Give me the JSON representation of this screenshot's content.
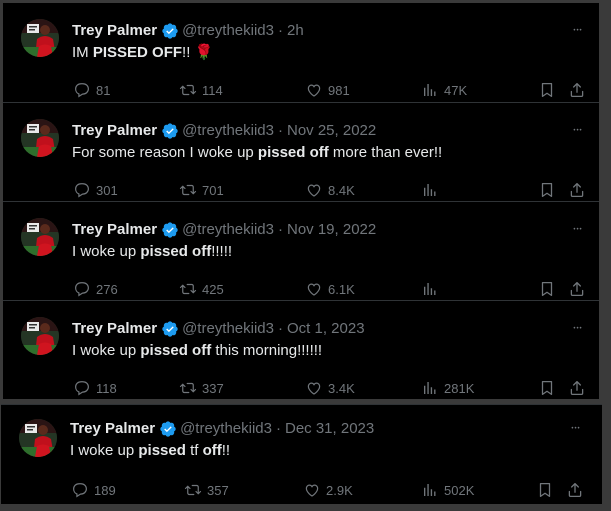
{
  "colors": {
    "verified": "#1d9bf0",
    "secondary_text": "#71767b",
    "primary_text": "#e7e9ea",
    "background": "#000000",
    "divider": "#2f3336"
  },
  "icons": {
    "reply": "speech-bubble",
    "retweet": "retweet-arrows",
    "like": "heart",
    "views": "bar-chart",
    "bookmark": "bookmark",
    "share": "upload-arrow",
    "verified": "verified-badge",
    "more": "three-dots"
  },
  "tweets": [
    {
      "name": "Trey Palmer",
      "handle": "@treythekiid3",
      "time": "2h",
      "text_parts": [
        "IM ",
        "PISSED OFF",
        "!! 🌹"
      ],
      "replies": "81",
      "retweets": "114",
      "likes": "981",
      "views": "47K"
    },
    {
      "name": "Trey Palmer",
      "handle": "@treythekiid3",
      "time": "Nov 25, 2022",
      "text_parts": [
        "For some reason I woke up ",
        "pissed off",
        " more than ever!!"
      ],
      "replies": "301",
      "retweets": "701",
      "likes": "8.4K",
      "views": ""
    },
    {
      "name": "Trey Palmer",
      "handle": "@treythekiid3",
      "time": "Nov 19, 2022",
      "text_parts": [
        "I woke up ",
        "pissed off",
        "!!!!!"
      ],
      "replies": "276",
      "retweets": "425",
      "likes": "6.1K",
      "views": ""
    },
    {
      "name": "Trey Palmer",
      "handle": "@treythekiid3",
      "time": "Oct 1, 2023",
      "text_parts": [
        "I woke up ",
        "pissed off",
        " this morning!!!!!!"
      ],
      "replies": "118",
      "retweets": "337",
      "likes": "3.4K",
      "views": "281K"
    },
    {
      "name": "Trey Palmer",
      "handle": "@treythekiid3",
      "time": "Dec 31, 2023",
      "text_parts": [
        "I woke up ",
        "pissed",
        " tf ",
        "off",
        "!!"
      ],
      "replies": "189",
      "retweets": "357",
      "likes": "2.9K",
      "views": "502K"
    }
  ]
}
